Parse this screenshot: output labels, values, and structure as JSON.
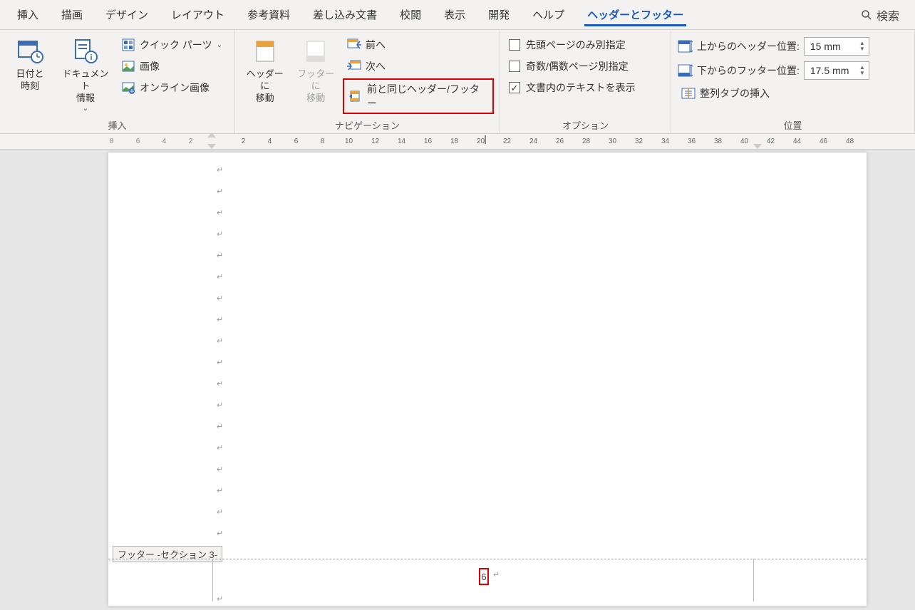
{
  "tabs": {
    "insert": "挿入",
    "draw": "描画",
    "design": "デザイン",
    "layout": "レイアウト",
    "references": "参考資料",
    "mailings": "差し込み文書",
    "review": "校閲",
    "view": "表示",
    "developer": "開発",
    "help": "ヘルプ",
    "header_footer": "ヘッダーとフッター"
  },
  "search": {
    "label": "検索"
  },
  "ribbon": {
    "insert_group": {
      "label": "挿入",
      "date_time": "日付と\n時刻",
      "doc_info": "ドキュメント\n情報",
      "quick_parts": "クイック パーツ",
      "picture": "画像",
      "online_picture": "オンライン画像"
    },
    "nav_group": {
      "label": "ナビゲーション",
      "goto_header": "ヘッダーに\n移動",
      "goto_footer": "フッターに\n移動",
      "previous": "前へ",
      "next": "次へ",
      "link_previous": "前と同じヘッダー/フッター"
    },
    "options_group": {
      "label": "オプション",
      "first_page": "先頭ページのみ別指定",
      "odd_even": "奇数/偶数ページ別指定",
      "show_text": "文書内のテキストを表示"
    },
    "position_group": {
      "label": "位置",
      "header_from_top": "上からのヘッダー位置:",
      "footer_from_bottom": "下からのフッター位置:",
      "header_value": "15 mm",
      "footer_value": "17.5 mm",
      "align_tab": "整列タブの挿入"
    }
  },
  "ruler": {
    "marks": [
      "8",
      "6",
      "4",
      "2",
      "",
      "2",
      "4",
      "6",
      "8",
      "10",
      "12",
      "14",
      "16",
      "18",
      "20",
      "22",
      "24",
      "26",
      "28",
      "30",
      "32",
      "34",
      "36",
      "38",
      "40",
      "42",
      "44",
      "46",
      "48"
    ]
  },
  "page": {
    "footer_tag": "フッター -セクション 3-",
    "page_number": "6"
  }
}
